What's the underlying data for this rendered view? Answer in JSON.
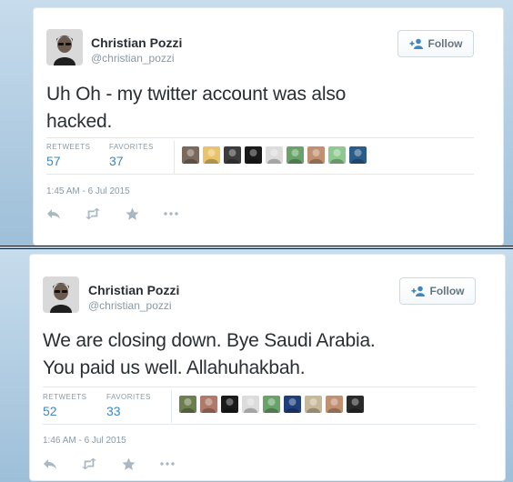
{
  "tweets": [
    {
      "author_name": "Christian Pozzi",
      "author_handle": "@christian_pozzi",
      "follow_label": "Follow",
      "text_lines": [
        "Uh Oh - my twitter account was also",
        "hacked."
      ],
      "retweets_label": "RETWEETS",
      "retweets_count": "57",
      "favorites_label": "FAVORITES",
      "favorites_count": "37",
      "timestamp": "1:45 AM - 6 Jul 2015",
      "favoriter_avatar_colors": [
        "#7b6a5c",
        "#e9c46a",
        "#3c3c3c",
        "#1a1a1a",
        "#dcdcdc",
        "#6aa36a",
        "#c09070",
        "#8fc98f",
        "#2b5d8a"
      ]
    },
    {
      "author_name": "Christian Pozzi",
      "author_handle": "@christian_pozzi",
      "follow_label": "Follow",
      "text_lines": [
        "We are closing down. Bye Saudi Arabia.",
        "You paid us well. Allahuhakbah."
      ],
      "retweets_label": "RETWEETS",
      "retweets_count": "52",
      "favorites_label": "FAVORITES",
      "favorites_count": "33",
      "timestamp": "1:46 AM - 6 Jul 2015",
      "favoriter_avatar_colors": [
        "#6d7f4f",
        "#b07a6a",
        "#1a1a1a",
        "#dcdcdc",
        "#6aa36a",
        "#1f3f7a",
        "#c8b89a",
        "#c09070",
        "#2a2a2a"
      ]
    }
  ],
  "icons": {
    "avatar": "person-sunglasses-icon",
    "follow": "add-user-icon",
    "reply": "reply-icon",
    "retweet": "retweet-icon",
    "favorite": "star-icon",
    "more": "more-dots-icon"
  }
}
